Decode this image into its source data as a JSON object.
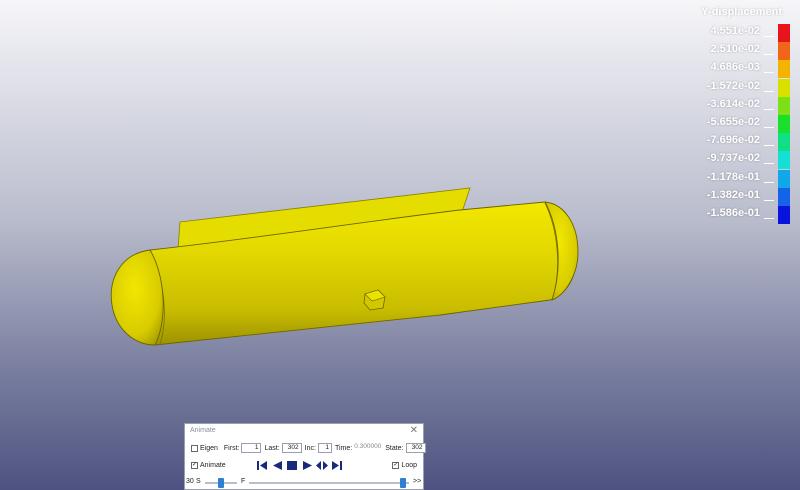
{
  "legend": {
    "title": "Y-displacement",
    "entries": [
      {
        "label": "4.551e-02",
        "color": "#e8131b"
      },
      {
        "label": "2.510e-02",
        "color": "#f06616"
      },
      {
        "label": "4.686e-03",
        "color": "#f2b400"
      },
      {
        "label": "-1.572e-02",
        "color": "#d8e000"
      },
      {
        "label": "-3.614e-02",
        "color": "#7ce014"
      },
      {
        "label": "-5.655e-02",
        "color": "#19e02a"
      },
      {
        "label": "-7.696e-02",
        "color": "#0fe085"
      },
      {
        "label": "-9.737e-02",
        "color": "#14e0d6"
      },
      {
        "label": "-1.178e-01",
        "color": "#10a8e8"
      },
      {
        "label": "-1.382e-01",
        "color": "#1763e8"
      },
      {
        "label": "-1.586e-01",
        "color": "#0a12e0"
      }
    ]
  },
  "model": {
    "color": "#e6dd00"
  },
  "animate_dialog": {
    "title": "Animate",
    "close_glyph": "✕",
    "eigen_label": "Eigen",
    "eigen_checked": false,
    "first_label": "First:",
    "first_value": "1",
    "last_label": "Last:",
    "last_value": "302",
    "inc_label": "Inc:",
    "inc_value": "1",
    "time_label": "Time:",
    "time_value": "0.300000",
    "state_label": "State:",
    "state_value": "302",
    "animate_label": "Animate",
    "animate_checked": true,
    "loop_label": "Loop",
    "loop_checked": true,
    "check_glyph": "✓",
    "speed_value": "30",
    "speed_slow_label": "S",
    "speed_fast_label": "F",
    "frame_slider_end_label": ">>",
    "speed_level": 0.5,
    "frame_level": 1.0
  }
}
